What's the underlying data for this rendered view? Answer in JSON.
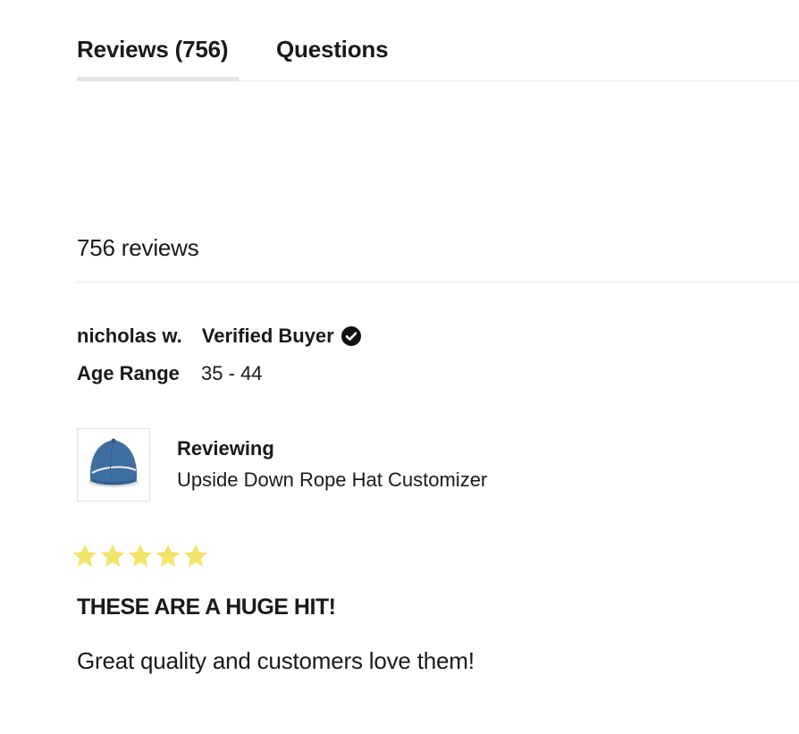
{
  "tabs": [
    {
      "label": "Reviews (756)",
      "active": true
    },
    {
      "label": "Questions",
      "active": false
    }
  ],
  "summary": {
    "review_count_text": "756 reviews"
  },
  "review": {
    "reviewer_name": "nicholas w.",
    "verified_label": "Verified Buyer",
    "verified_icon": "verified-check-icon",
    "age_range_label": "Age Range",
    "age_range_value": "35 - 44",
    "reviewing_label": "Reviewing",
    "product_name": "Upside Down Rope Hat Customizer",
    "product_image": "blue-rope-hat",
    "rating": 5,
    "rating_max": 5,
    "title": "THESE ARE A HUGE HIT!",
    "body": "Great quality and customers love them!"
  },
  "colors": {
    "star": "#f2e46b",
    "hat": "#3f6fa0",
    "tab_underline": "#dfe4e7",
    "divider": "#e3e6e8"
  }
}
